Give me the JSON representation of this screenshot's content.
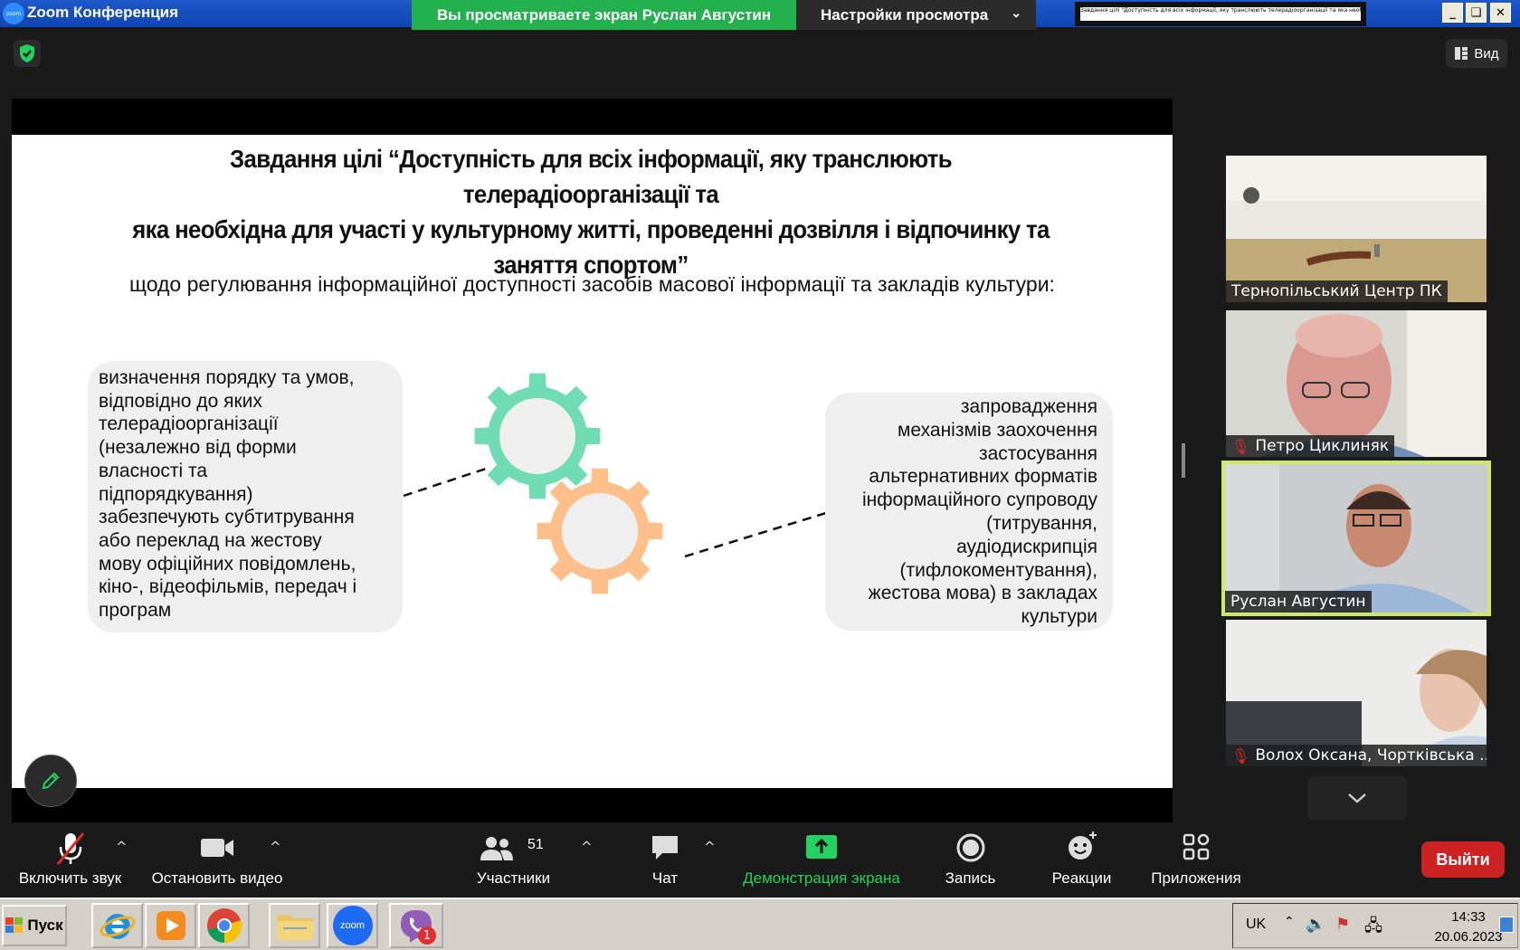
{
  "window": {
    "app_title": "Zoom Конференция",
    "share_banner": "Вы просматриваете экран Руслан Августин",
    "view_options": "Настройки просмотра",
    "thumb_text": "Завдання цілі \"Доступність для всіх інформації, яку транслюють телерадіоорганізації та яка необхідна для участі у культурному житті, проведенні дозвілля і відпочинку та заняття спортом\"",
    "view_button": "Вид"
  },
  "slide": {
    "title_lines": [
      "Завдання цілі “Доступність для всіх інформації, яку транслюють телерадіоорганізації та",
      "яка необхідна для участі у культурному житті, проведенні дозвілля і відпочинку та",
      "заняття спортом”"
    ],
    "subtitle": "щодо регулювання інформаційної доступності засобів масової інформації та закладів культури:",
    "left_box": "визначення порядку та умов,\nвідповідно до яких\nтелерадіоорганізації\n(незалежно від форми\nвласності та\nпідпорядкування)\nзабезпечують субтитрування\nабо переклад на жестову\nмову офіційних повідомлень,\nкіно-, відеофільмів, передач і\nпрограм",
    "right_box": "запровадження\nмеханізмів заохочення\nзастосування\nальтернативних форматів\nінформаційного супроводу\n(титрування,\nаудіодискрипція\n(тифлокоментування),\nжестова мова) в закладах\nкультури",
    "gear_top_color": "#6fdcb3",
    "gear_bottom_color": "#ffbf8a"
  },
  "participants_rail": [
    {
      "name": "Тернопільський Центр ПК",
      "muted": false
    },
    {
      "name": "Петро Циклиняк",
      "muted": true
    },
    {
      "name": "Руслан Августин",
      "muted": false,
      "active": true
    },
    {
      "name": "Волох Оксана, Чортківська ...",
      "muted": true
    }
  ],
  "toolbar": {
    "unmute": "Включить звук",
    "stop_video": "Остановить видео",
    "participants": "Участники",
    "participants_count": "51",
    "chat": "Чат",
    "share": "Демонстрация экрана",
    "record": "Запись",
    "reactions": "Реакции",
    "apps": "Приложения",
    "leave": "Выйти"
  },
  "taskbar": {
    "start": "Пуск",
    "zoom_label": "zoom",
    "viber_badge": "1",
    "lang": "UK",
    "time": "14:33",
    "date": "20.06.2023"
  }
}
